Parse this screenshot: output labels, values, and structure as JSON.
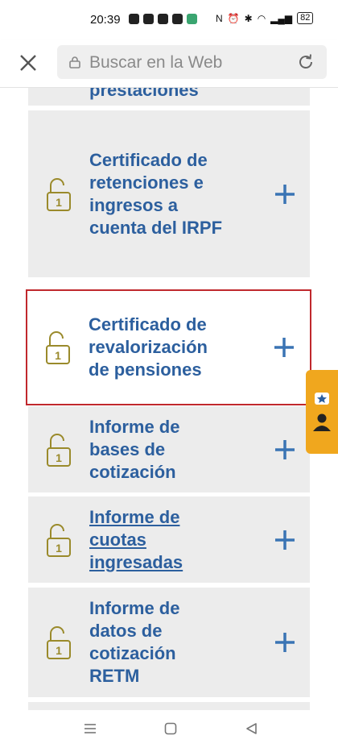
{
  "status_bar": {
    "time": "20:39",
    "battery": "82"
  },
  "browser": {
    "search_placeholder": "Buscar en la Web"
  },
  "top_partial_item": {
    "title": "prestaciones"
  },
  "items": [
    {
      "title": "Certificado de retenciones e ingresos a cuenta del IRPF",
      "padlock_number": "1",
      "highlighted": false,
      "link": false
    },
    {
      "title": "Certificado de revalorización de pensiones",
      "padlock_number": "1",
      "highlighted": true,
      "link": false
    },
    {
      "title": "Informe de bases de cotización",
      "padlock_number": "1",
      "highlighted": false,
      "link": false
    },
    {
      "title": "Informe de cuotas ingresadas",
      "padlock_number": "1",
      "highlighted": false,
      "link": true
    },
    {
      "title": "Informe de datos de cotización RETM",
      "padlock_number": "1",
      "highlighted": false,
      "link": false
    }
  ],
  "colors": {
    "title": "#2c5f9e",
    "padlock": "#9a8a2b",
    "plus": "#3a74b4",
    "highlight_border": "#c0282d",
    "side_tab": "#f0a71e"
  }
}
